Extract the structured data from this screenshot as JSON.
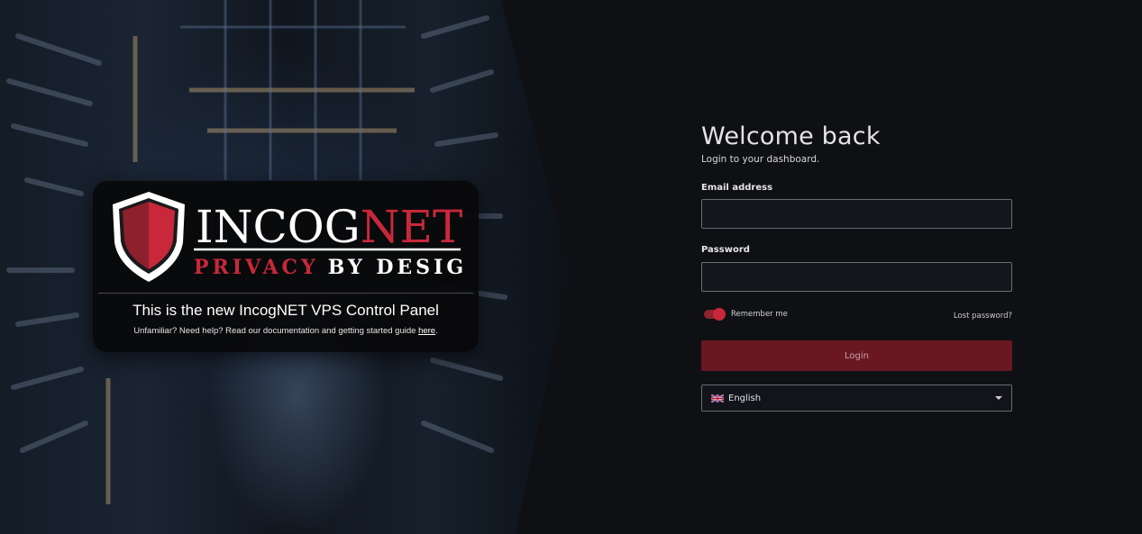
{
  "colors": {
    "accent": "#c8283a",
    "button_bg": "#6a1722",
    "page_bg": "#0f1014"
  },
  "brand": {
    "name_part1": "INCOG",
    "name_part2": "NET",
    "tagline_part1": "PRIVACY",
    "tagline_part2": "BY DESIGN",
    "icon": "shield-icon"
  },
  "promo": {
    "title": "This is the new IncogNET VPS Control Panel",
    "subtitle_prefix": "Unfamiliar? Need help? Read our documentation and getting started guide ",
    "subtitle_link": "here",
    "subtitle_suffix": "."
  },
  "login": {
    "heading": "Welcome back",
    "subheading": "Login to your dashboard.",
    "email_label": "Email address",
    "email_value": "",
    "password_label": "Password",
    "password_value": "",
    "remember_label": "Remember me",
    "remember_checked": true,
    "lost_password": "Lost password?",
    "submit_label": "Login"
  },
  "language": {
    "selected": "English",
    "flag_icon": "uk-flag-icon"
  }
}
